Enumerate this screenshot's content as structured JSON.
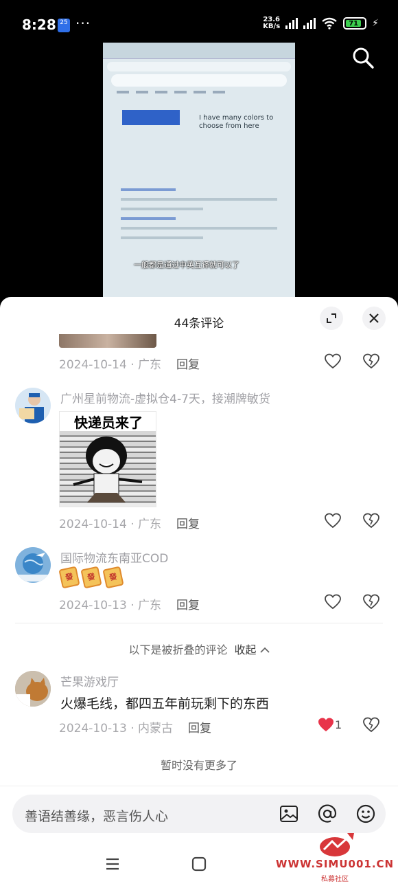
{
  "status": {
    "time": "8:28",
    "date_badge": "25",
    "more": "···",
    "net_speed_value": "23.6",
    "net_speed_unit": "KB/s",
    "battery": "71"
  },
  "video": {
    "subtitle": "一般都是通过中英互译就可以了",
    "translated_text": "I have many colors to choose from here"
  },
  "comments_panel": {
    "title": "44条评论",
    "reply_label": "回复",
    "comments": [
      {
        "date": "2024-10-14",
        "region": "广东"
      },
      {
        "username": "广州星前物流-虚拟仓4-7天，接潮牌敏货",
        "meme_caption": "快递员来了",
        "date": "2024-10-14",
        "region": "广东"
      },
      {
        "username": "国际物流东南亚COD",
        "emoji_text": "發",
        "date": "2024-10-13",
        "region": "广东"
      },
      {
        "username": "芒果游戏厅",
        "text": "火爆毛线，都四五年前玩剩下的东西",
        "date": "2024-10-13",
        "region": "内蒙古",
        "likes": "1"
      }
    ],
    "folded_notice": "以下是被折叠的评论",
    "collapse_label": "收起",
    "no_more": "暂时没有更多了"
  },
  "input": {
    "placeholder": "善语结善缘，恶言伤人心"
  },
  "watermark": {
    "site": "WWW.SIMU001.CN",
    "sub": "私募社区"
  },
  "colors": {
    "like_red": "#e8344a",
    "battery_green": "#3ccf4e"
  }
}
